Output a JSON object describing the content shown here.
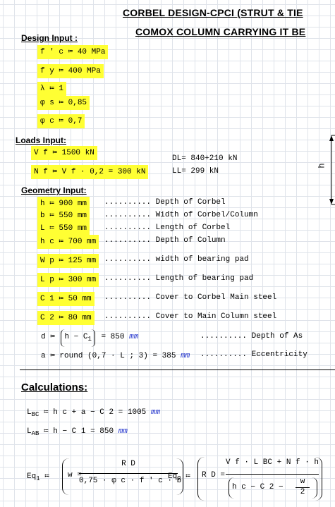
{
  "header": {
    "title_line1": "CORBEL DESIGN-CPCI (STRUT & TIE",
    "title_line2": "COMOX COLUMN CARRYING IT BE"
  },
  "design_input": {
    "heading": "Design Input :",
    "fc": "f ' c ≔ 40 MPa",
    "fy": "f y ≔ 400 MPa",
    "lambda": "λ ≔ 1",
    "phi_s": "φ s ≔ 0,85",
    "phi_c": "φ c ≔ 0,7"
  },
  "loads_input": {
    "heading": "Loads Input:",
    "vf": "V f ≔ 1500 kN",
    "nf": "N f ≔ V f · 0,2 = 300 kN",
    "dl_note": "DL= 840+210 kN",
    "ll_note": "LL= 299 kN"
  },
  "geometry_input": {
    "heading": "Geometry Input:",
    "rows": [
      {
        "expr": "h ≔ 900 mm",
        "desc": ".......... Depth of Corbel"
      },
      {
        "expr": "b ≔ 550 mm",
        "desc": ".......... Width of Corbel/Column"
      },
      {
        "expr": "L ≔ 550 mm",
        "desc": ".......... Length of Corbel"
      },
      {
        "expr": "h c ≔ 700 mm",
        "desc": ".......... Depth of Column"
      },
      {
        "expr": "W p ≔ 125 mm",
        "desc": ".......... width of bearing pad"
      },
      {
        "expr": "L p ≔ 300 mm",
        "desc": ".......... Length of bearing pad"
      },
      {
        "expr": "C 1 ≔ 50 mm",
        "desc": ".......... Cover to Corbel Main steel"
      },
      {
        "expr": "C 2 ≔ 80 mm",
        "desc": ".......... Cover to Main Column steel"
      }
    ],
    "d_expr_pre": "d ≔",
    "d_expr_inner": "h − C",
    "d_expr_sub": "1",
    "d_expr_result": "= 850",
    "d_unit": "mm",
    "d_desc": ".......... Depth of As",
    "a_expr": "a ≔ round (0,7 · L ; 3) = 385",
    "a_unit": "mm",
    "a_desc": ".......... Eccentricity"
  },
  "calculations": {
    "heading": "Calculations:",
    "lbc_lhs": "L",
    "lbc_sub": "BC",
    "lbc_rhs": "≔ h c + a − C 2 = 1005",
    "lbc_unit": "mm",
    "lab_lhs": "L",
    "lab_sub": "AB",
    "lab_rhs": "≔ h − C 1 = 850",
    "lab_unit": "mm",
    "eq1_label": "Eq",
    "eq1_sub": "1",
    "eq1_assign": "≔",
    "eq1_lhs": "w =",
    "eq1_num": "R D",
    "eq1_den": "0,75 · φ c · f ' c · b",
    "eq2_label": "Eq",
    "eq2_sub": "2",
    "eq2_assign": "≔",
    "eq2_lhs": "R D =",
    "eq2_num": "V f · L BC + N f · h",
    "eq2_den_pre": "h c − C 2 −",
    "eq2_den_frac_num": "w",
    "eq2_den_frac_den": "2"
  },
  "diagram": {
    "dim_label": "h"
  }
}
